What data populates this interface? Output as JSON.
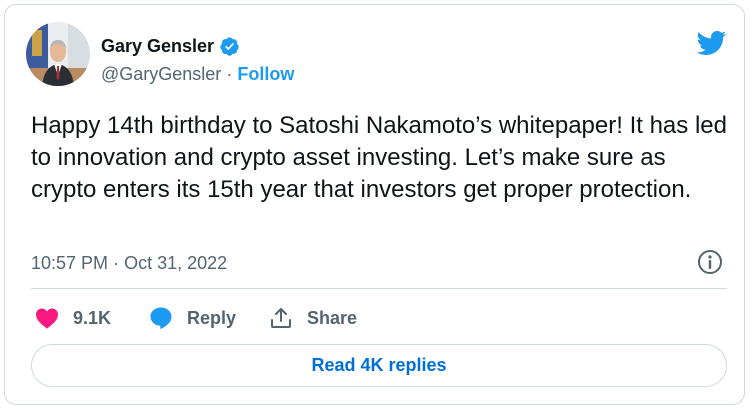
{
  "author": {
    "display_name": "Gary Gensler",
    "handle": "@GaryGensler",
    "separator": "·",
    "follow_label": "Follow",
    "verified": true
  },
  "tweet": {
    "text": "Happy 14th birthday to Satoshi Nakamoto’s whitepaper! It has led to innovation and crypto asset investing. Let’s make sure as crypto enters its 15th year that investors get proper protection.",
    "time": "10:57 PM",
    "meta_separator": "·",
    "date": "Oct 31, 2022"
  },
  "actions": {
    "likes_count": "9.1K",
    "reply_label": "Reply",
    "share_label": "Share"
  },
  "footer": {
    "read_replies_label": "Read 4K replies"
  },
  "icons": {
    "brand": "twitter-bird-icon",
    "verified": "verified-badge-icon",
    "info": "info-icon",
    "like": "heart-icon",
    "reply": "speech-bubble-icon",
    "share": "share-icon"
  },
  "colors": {
    "twitter_blue": "#1d9bf0",
    "like_pink": "#f91880",
    "reply_link_blue": "#006fd6",
    "secondary_text": "#536471",
    "primary_text": "#0f1419",
    "border": "#cfd9de"
  }
}
